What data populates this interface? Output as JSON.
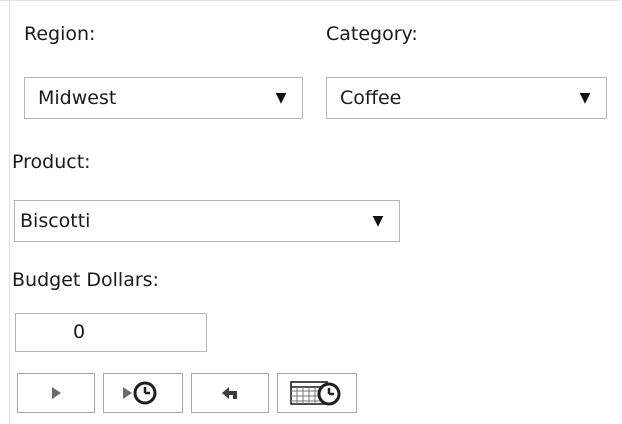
{
  "filters": {
    "region": {
      "label": "Region:",
      "value": "Midwest"
    },
    "category": {
      "label": "Category:",
      "value": "Coffee"
    },
    "product": {
      "label": "Product:",
      "value": "Biscotti"
    }
  },
  "budget": {
    "label": "Budget Dollars:",
    "value": "0"
  },
  "toolbar": {
    "buttons": [
      {
        "icon": "play-icon"
      },
      {
        "icon": "play-scheduled-icon"
      },
      {
        "icon": "undo-icon"
      },
      {
        "icon": "schedule-grid-icon"
      }
    ]
  },
  "colors": {
    "border": "#b5b5b5",
    "frame": "#e2e2e2",
    "icon_gray": "#6b6b6b",
    "icon_dark": "#1e1e1e"
  },
  "caret_glyph": "▼"
}
